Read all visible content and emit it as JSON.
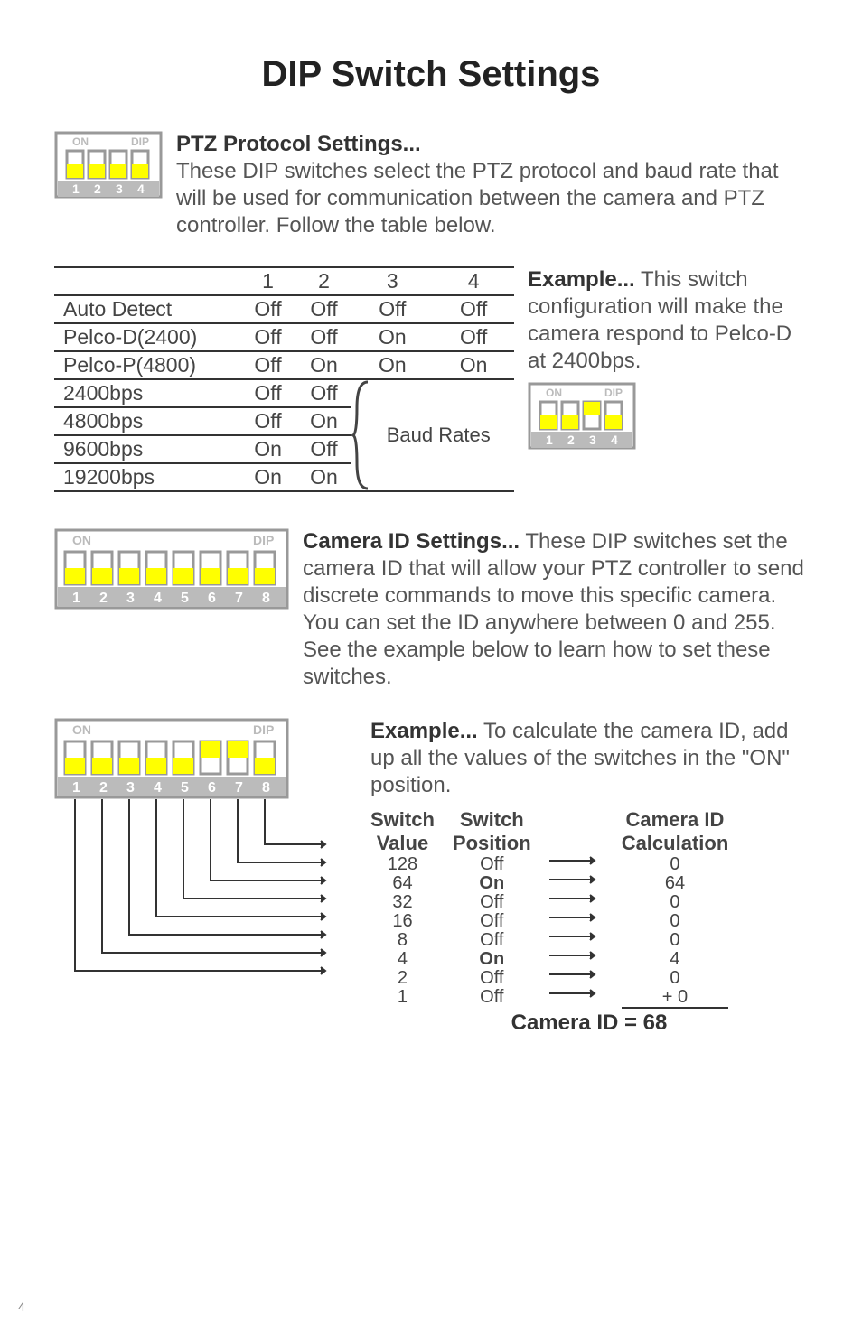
{
  "page_number": "4",
  "title": "DIP Switch Settings",
  "ptz_protocol": {
    "heading": "PTZ Protocol Settings...",
    "body": "These DIP switches select the PTZ protocol and baud rate that will be used for communication between the camera and PTZ controller. Follow the table below.",
    "dip4_labels": {
      "on": "ON",
      "dip": "DIP",
      "n1": "1",
      "n2": "2",
      "n3": "3",
      "n4": "4"
    }
  },
  "table": {
    "headers": {
      "c1": "1",
      "c2": "2",
      "c3": "3",
      "c4": "4"
    },
    "rows": {
      "auto_detect": {
        "label": "Auto Detect",
        "c1": "Off",
        "c2": "Off",
        "c3": "Off",
        "c4": "Off"
      },
      "pelco_d": {
        "label": "Pelco-D(2400)",
        "c1": "Off",
        "c2": "Off",
        "c3": "On",
        "c4": "Off"
      },
      "pelco_p": {
        "label": "Pelco-P(4800)",
        "c1": "Off",
        "c2": "On",
        "c3": "On",
        "c4": "On"
      },
      "b2400": {
        "label": "2400bps",
        "c1": "Off",
        "c2": "Off"
      },
      "b4800": {
        "label": "4800bps",
        "c1": "Off",
        "c2": "On"
      },
      "b9600": {
        "label": "9600bps",
        "c1": "On",
        "c2": "Off"
      },
      "b19200": {
        "label": "19200bps",
        "c1": "On",
        "c2": "On"
      }
    },
    "baud_label": "Baud Rates"
  },
  "example1": {
    "prefix": "Example...",
    "body": " This switch configuration will make the camera respond to Pelco-D at 2400bps.",
    "dip4_labels": {
      "on": "ON",
      "dip": "DIP",
      "n1": "1",
      "n2": "2",
      "n3": "3",
      "n4": "4"
    }
  },
  "camera_id": {
    "heading": "Camera ID Settings...",
    "body": " These DIP switches set the camera ID that will allow your PTZ controller to send discrete commands to move this specific camera. You can set the ID anywhere between 0 and 255. See the example below to learn how to set these switches.",
    "dip8_labels": {
      "on": "ON",
      "dip": "DIP",
      "n1": "1",
      "n2": "2",
      "n3": "3",
      "n4": "4",
      "n5": "5",
      "n6": "6",
      "n7": "7",
      "n8": "8"
    }
  },
  "example2": {
    "prefix": "Example...",
    "body": " To calculate the camera ID, add up all the values of the switches in the \"ON\" position.",
    "dip8_labels": {
      "on": "ON",
      "dip": "DIP",
      "n1": "1",
      "n2": "2",
      "n3": "3",
      "n4": "4",
      "n5": "5",
      "n6": "6",
      "n7": "7",
      "n8": "8"
    },
    "calc_headers": {
      "switch_value": "Switch Value",
      "switch_position": "Switch Position",
      "camera_id_calc": "Camera ID Calculation"
    },
    "switch_values": {
      "v128": "128",
      "v64": "64",
      "v32": "32",
      "v16": "16",
      "v8": "8",
      "v4": "4",
      "v2": "2",
      "v1": "1"
    },
    "switch_positions": {
      "p128": "Off",
      "p64": "On",
      "p32": "Off",
      "p16": "Off",
      "p8": "Off",
      "p4": "On",
      "p2": "Off",
      "p1": "Off"
    },
    "calc_values": {
      "r128": "0",
      "r64": "64",
      "r32": "0",
      "r16": "0",
      "r8": "0",
      "r4": "4",
      "r2": "0",
      "r1": "+  0"
    },
    "total": "Camera ID = 68"
  }
}
